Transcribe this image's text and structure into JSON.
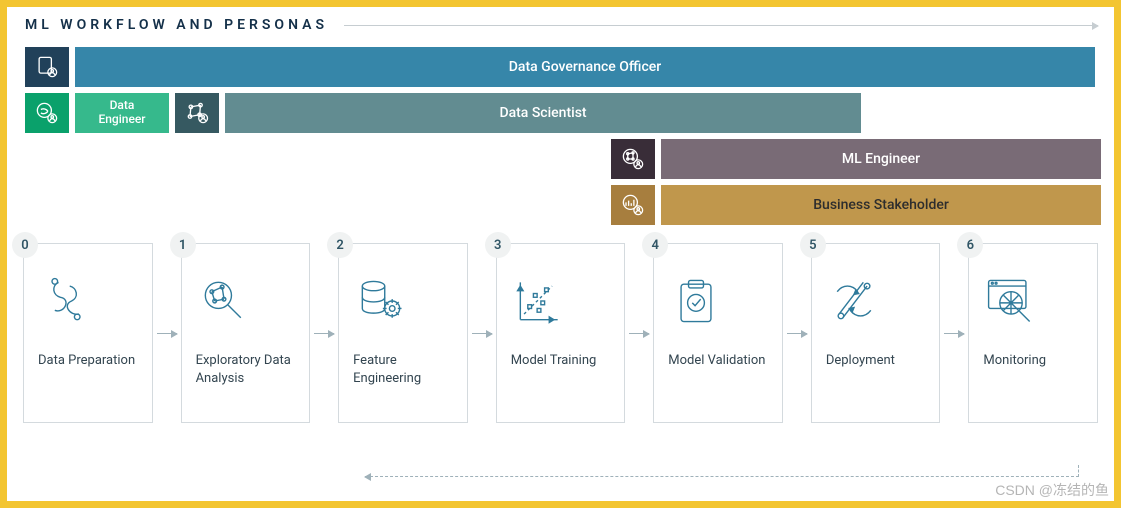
{
  "title": "ML WORKFLOW AND PERSONAS",
  "personas": {
    "gov": {
      "label": "Data Governance Officer",
      "color_icon": "#21415a",
      "color_bar": "#3686a9"
    },
    "eng": {
      "label": "Data Engineer",
      "color_icon": "#0aa16b",
      "color_bar": "#36b98c"
    },
    "sci": {
      "label": "Data Scientist",
      "color_icon": "#365961",
      "color_bar": "#628c91"
    },
    "ml": {
      "label": "ML Engineer",
      "color_icon": "#392d38",
      "color_bar": "#796b76"
    },
    "bs": {
      "label": "Business Stakeholder",
      "color_icon": "#a77e3e",
      "color_bar": "#c0974c"
    }
  },
  "steps": [
    {
      "num": "0",
      "label": "Data Preparation"
    },
    {
      "num": "1",
      "label": "Exploratory Data Analysis"
    },
    {
      "num": "2",
      "label": "Feature Engineering"
    },
    {
      "num": "3",
      "label": "Model Training"
    },
    {
      "num": "4",
      "label": "Model Validation"
    },
    {
      "num": "5",
      "label": "Deployment"
    },
    {
      "num": "6",
      "label": "Monitoring"
    }
  ],
  "watermark": "CSDN @冻结的鱼",
  "chart_data": {
    "type": "table",
    "description": "Gantt-style mapping of personas to ML workflow stages 0–6",
    "stages": [
      "Data Preparation",
      "Exploratory Data Analysis",
      "Feature Engineering",
      "Model Training",
      "Model Validation",
      "Deployment",
      "Monitoring"
    ],
    "persona_coverage": {
      "Data Governance Officer": [
        0,
        1,
        2,
        3,
        4,
        5,
        6
      ],
      "Data Engineer": [
        0
      ],
      "Data Scientist": [
        1,
        2,
        3,
        4
      ],
      "ML Engineer": [
        4,
        5,
        6
      ],
      "Business Stakeholder": [
        4,
        5,
        6
      ]
    },
    "feedback_loop": {
      "from_stage": 6,
      "to_stage": 2
    }
  }
}
